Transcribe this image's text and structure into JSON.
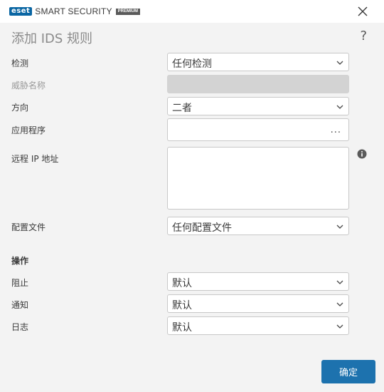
{
  "app": {
    "brand": "eset",
    "product": "SMART SECURITY",
    "edition": "PREMIUM"
  },
  "dialog": {
    "title": "添加 IDS 规则",
    "help": "?"
  },
  "form": {
    "detection": {
      "label": "检测",
      "value": "任何检测"
    },
    "threat_name": {
      "label": "威胁名称",
      "value": ""
    },
    "direction": {
      "label": "方向",
      "value": "二者"
    },
    "application": {
      "label": "应用程序",
      "value": "",
      "browse": "..."
    },
    "remote_ip": {
      "label": "远程 IP 地址",
      "value": ""
    },
    "profile": {
      "label": "配置文件",
      "value": "任何配置文件"
    }
  },
  "actions": {
    "section_label": "操作",
    "block": {
      "label": "阻止",
      "value": "默认"
    },
    "notify": {
      "label": "通知",
      "value": "默认"
    },
    "log": {
      "label": "日志",
      "value": "默认"
    }
  },
  "footer": {
    "ok_label": "确定"
  },
  "colors": {
    "accent": "#1d72ae",
    "brand": "#0a66a3",
    "background": "#f3f3f3"
  }
}
